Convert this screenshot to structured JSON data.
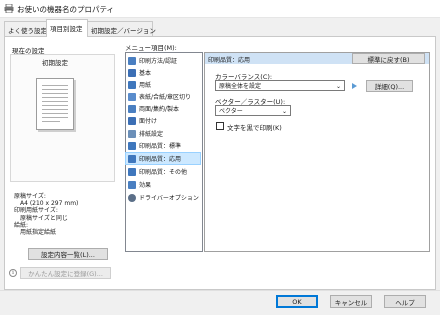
{
  "window": {
    "title": "お使いの機器名のプロパティ"
  },
  "tabs": [
    {
      "label": "よく使う設定"
    },
    {
      "label": "項目別設定"
    },
    {
      "label": "初期設定／バージョン"
    }
  ],
  "current_settings": {
    "label": "現在の設定",
    "preset": "初期設定",
    "summary": [
      "原稿サイズ:",
      "A4 (210 x 297 mm)",
      "印刷用紙サイズ:",
      "原稿サイズと同じ",
      "給紙:",
      "用紙指定給紙"
    ]
  },
  "buttons": {
    "settings_list": "設定内容一覧(L)...",
    "register_easy": "かんたん設定に登録(G)...",
    "restore_default": "標準に戻す(B)",
    "details": "詳細(Q)...",
    "ok": "OK",
    "cancel": "キャンセル",
    "help": "ヘルプ"
  },
  "menu": {
    "label": "メニュー項目(M):",
    "items": [
      {
        "label": "印刷方法/認証",
        "icon": "print-method-icon",
        "color": "#4a7fc1"
      },
      {
        "label": "基本",
        "icon": "basic-icon",
        "color": "#3c6fb5"
      },
      {
        "label": "用紙",
        "icon": "paper-icon",
        "color": "#3f77bd"
      },
      {
        "label": "表紙/合紙/章区切り",
        "icon": "cover-icon",
        "color": "#5a8ccc"
      },
      {
        "label": "両面/集約/製本",
        "icon": "duplex-icon",
        "color": "#4a7fc1"
      },
      {
        "label": "面付け",
        "icon": "imposition-icon",
        "color": "#3c6fb5"
      },
      {
        "label": "排紙設定",
        "icon": "output-icon",
        "color": "#6b8fb8"
      },
      {
        "label": "印刷品質：標準",
        "icon": "quality-standard-icon",
        "color": "#3f77bd"
      },
      {
        "label": "印刷品質：応用",
        "icon": "quality-advanced-icon",
        "color": "#3f77bd"
      },
      {
        "label": "印刷品質：その他",
        "icon": "quality-other-icon",
        "color": "#3f77bd"
      },
      {
        "label": "効果",
        "icon": "effect-icon",
        "color": "#4a7fc1"
      },
      {
        "label": "ドライバーオプション",
        "icon": "gear-icon",
        "color": "#5b6f88"
      }
    ],
    "selected_index": 8
  },
  "panel": {
    "header": "印刷品質：応用",
    "color_balance_label": "カラーバランス(C):",
    "color_balance_value": "原稿全体を設定",
    "vector_raster_label": "ベクター／ラスター(U):",
    "vector_raster_value": "ベクター",
    "black_text_label": "文字を黒で印刷(K)",
    "black_text_checked": false
  }
}
